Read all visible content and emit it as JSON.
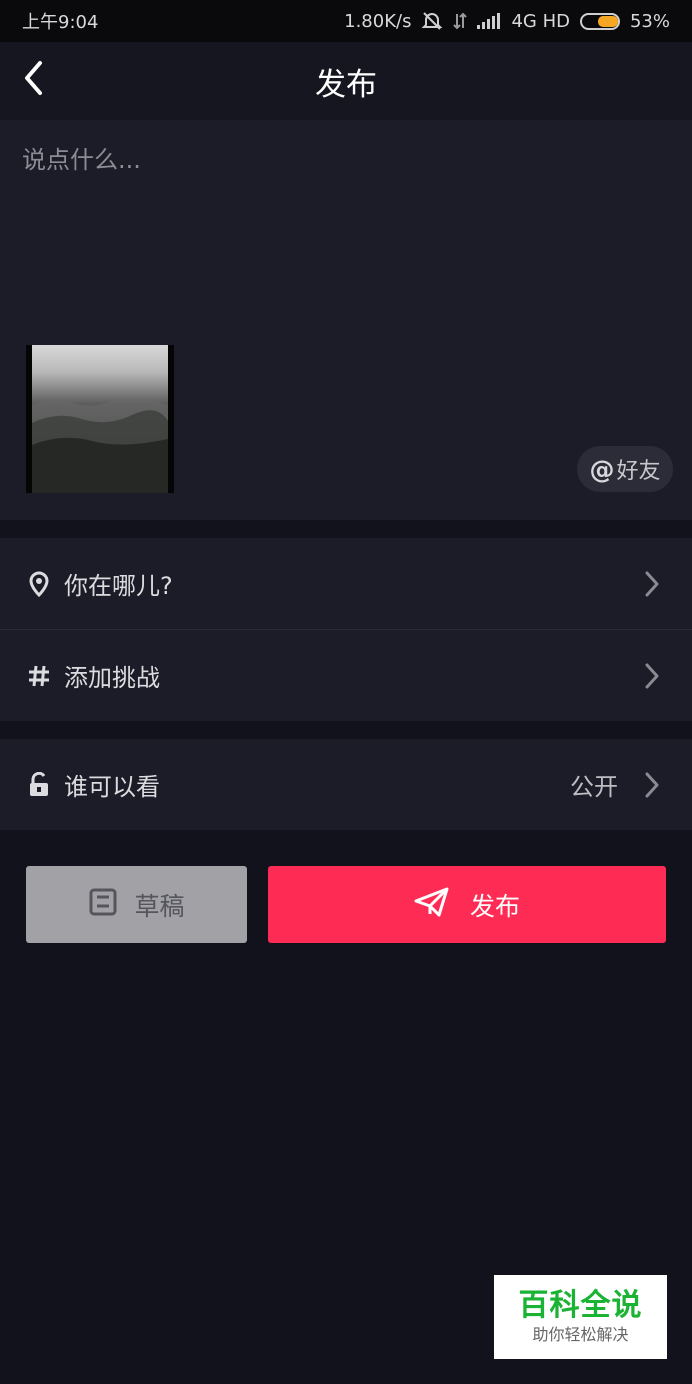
{
  "status_bar": {
    "time": "上午9:04",
    "net_speed": "1.80K/s",
    "network": "4G HD",
    "battery": "53%"
  },
  "header": {
    "title": "发布"
  },
  "compose": {
    "placeholder": "说点什么...",
    "mention_symbol": "@",
    "mention_label": "好友"
  },
  "options": {
    "location_label": "你在哪儿?",
    "challenge_label": "添加挑战",
    "privacy_label": "谁可以看",
    "privacy_value": "公开"
  },
  "actions": {
    "draft_label": "草稿",
    "publish_label": "发布"
  },
  "watermark": {
    "title": "百科全说",
    "subtitle": "助你轻松解决"
  },
  "colors": {
    "publish": "#fe2c55",
    "draft": "#a1a1a6",
    "background": "#12121c",
    "panel": "#1b1c27",
    "battery": "#f5a623",
    "watermark_text": "#1bb333"
  },
  "icons": {
    "back": "chevron-left-icon",
    "location": "location-pin-icon",
    "challenge": "hashtag-icon",
    "privacy": "unlock-icon",
    "draft": "save-icon",
    "publish": "paper-plane-icon"
  }
}
